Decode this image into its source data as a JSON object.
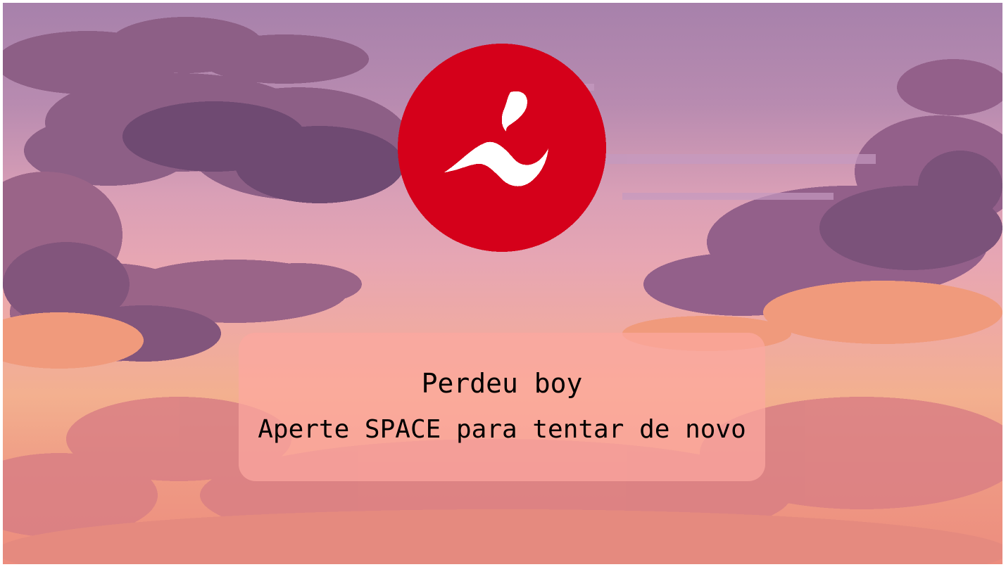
{
  "game": {
    "background": "sunset-pixel-clouds",
    "logo": {
      "icon": "red-circle-swimmer-logo",
      "color": "#d5001a"
    },
    "game_over": {
      "title": "Perdeu boy",
      "hint": "Aperte SPACE para tentar de novo"
    }
  }
}
